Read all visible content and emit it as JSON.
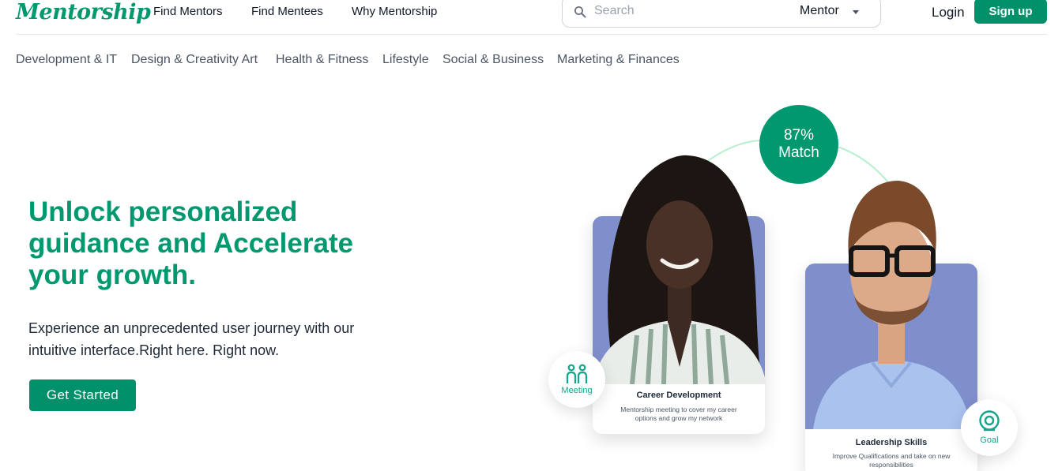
{
  "header": {
    "logo": "Mentorship",
    "nav": [
      "Find Mentors",
      "Find Mentees",
      "Why Mentorship"
    ],
    "search": {
      "placeholder": "Search",
      "role_value": "Mentor"
    },
    "login": "Login",
    "signup": "Sign up"
  },
  "categories": [
    "Development & IT",
    "Design & Creativity Art",
    "Health & Fitness",
    "Lifestyle",
    "Social & Business",
    "Marketing & Finances"
  ],
  "hero": {
    "title_line1": "Unlock personalized",
    "title_line2": "guidance and Accelerate",
    "title_line3": "your growth.",
    "subtitle_line1": "Experience an unprecedented user journey with our",
    "subtitle_line2": "intuitive interface.Right here. Right now.",
    "cta": "Get Started"
  },
  "illustration": {
    "match_percent": "87%",
    "match_label": "Match",
    "card1": {
      "title": "Career Development",
      "desc_line1": "Mentorship meeting to cover my career",
      "desc_line2": "options and grow my network"
    },
    "card2": {
      "title": "Leadership Skills",
      "desc_line1": "Improve Qualifications and take on new",
      "desc_line2": "responsibilities"
    },
    "badge_meeting": "Meeting",
    "badge_goal": "Goal"
  },
  "colors": {
    "brand": "#00996f",
    "button": "#00916a",
    "arc": "#b7efd0",
    "card_bg": "#7f8fcc"
  }
}
